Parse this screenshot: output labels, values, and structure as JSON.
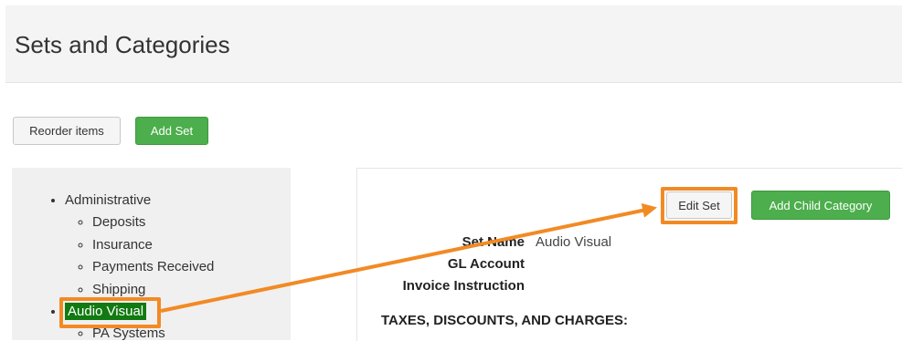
{
  "header": {
    "title": "Sets and Categories"
  },
  "toolbar": {
    "reorder_label": "Reorder items",
    "add_set_label": "Add Set"
  },
  "sidebar": {
    "items": [
      {
        "label": "Administrative",
        "children": [
          "Deposits",
          "Insurance",
          "Payments Received",
          "Shipping"
        ]
      },
      {
        "label": "Audio Visual",
        "selected": true,
        "children": [
          "PA Systems"
        ]
      }
    ]
  },
  "detail": {
    "edit_set_label": "Edit Set",
    "add_child_label": "Add Child Category",
    "fields": [
      {
        "label": "Set Name",
        "value": "Audio Visual"
      },
      {
        "label": "GL Account",
        "value": ""
      },
      {
        "label": "Invoice Instruction",
        "value": ""
      }
    ],
    "section_heading": "TAXES, DISCOUNTS, AND CHARGES:"
  },
  "colors": {
    "primary_green": "#4cae4c",
    "selected_bg": "#117a11",
    "annotation_orange": "#f28a24"
  }
}
